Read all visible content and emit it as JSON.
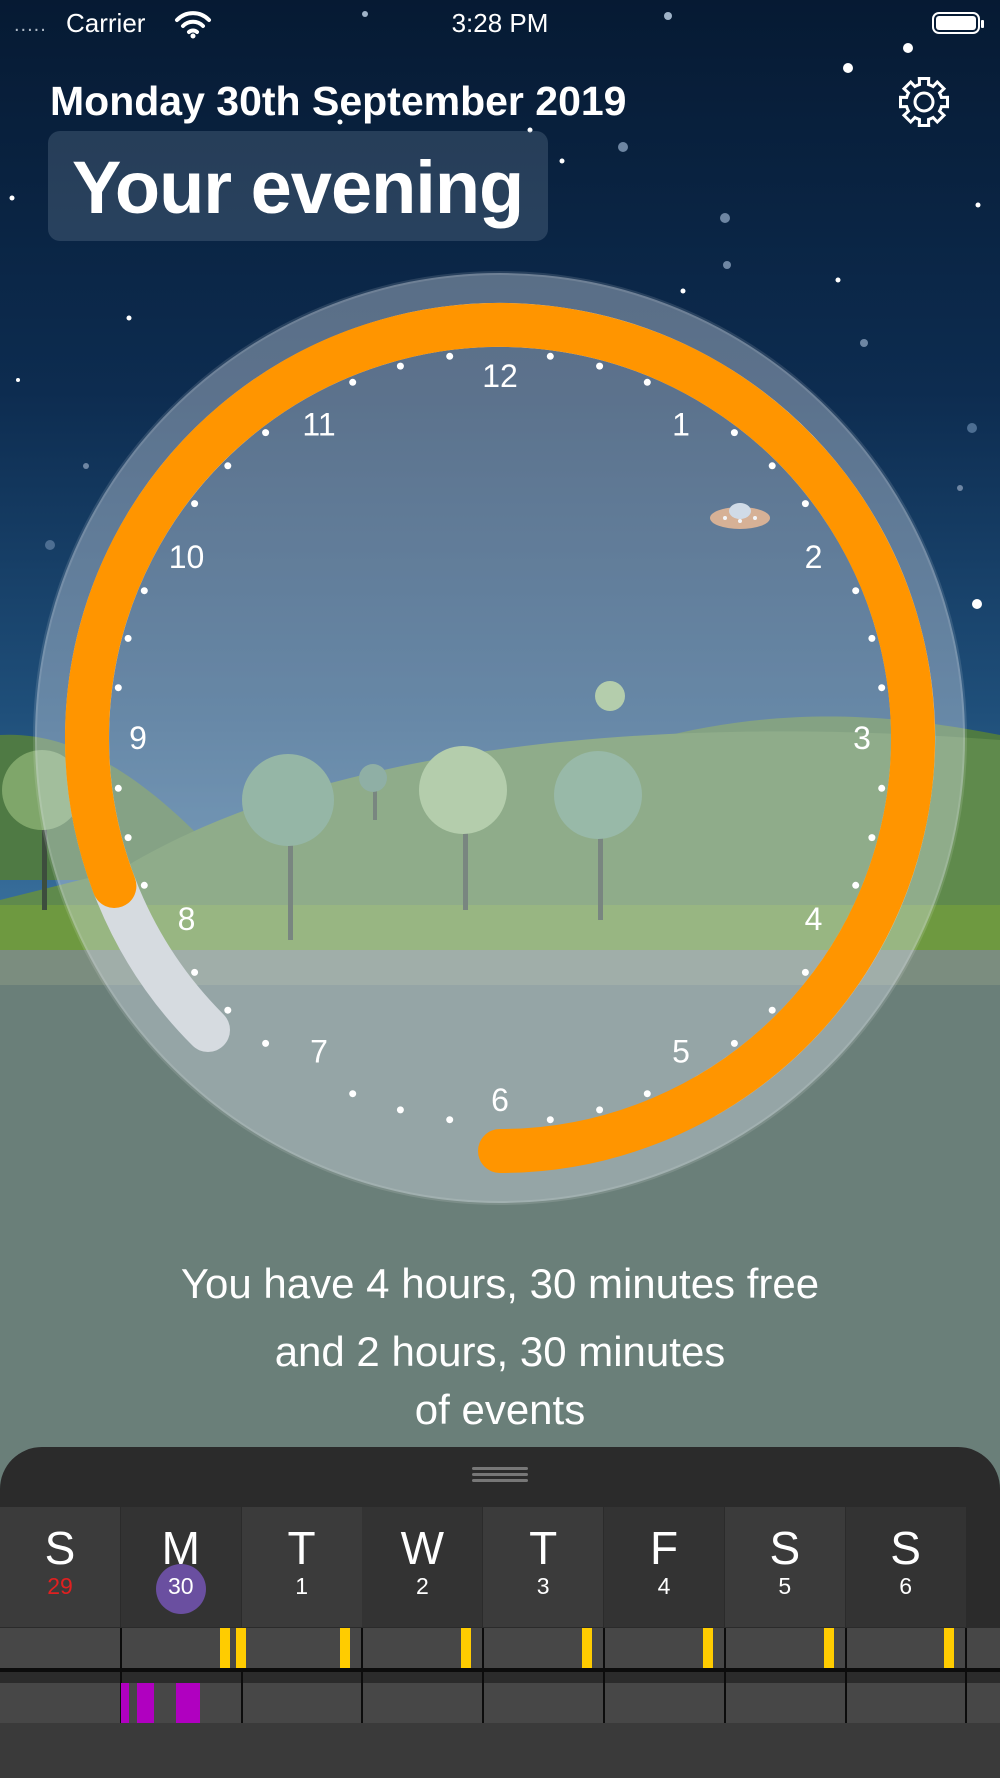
{
  "status": {
    "carrier": "Carrier",
    "time": "3:28 PM",
    "signal_dots": "....."
  },
  "header": {
    "date": "Monday 30th September 2019",
    "period": "Your evening"
  },
  "clock": {
    "hour_labels": [
      "12",
      "1",
      "2",
      "3",
      "4",
      "5",
      "6",
      "7",
      "8",
      "9",
      "10",
      "11"
    ],
    "free_arc_range": [
      7.5,
      5.0
    ],
    "events_arc_range": [
      8.3,
      6.0
    ],
    "colors": {
      "events": "#ff9500",
      "free": "#d6dbe0"
    }
  },
  "summary": {
    "line1": "You have 4 hours, 30 minutes free",
    "line2": "and 2 hours, 30 minutes",
    "line3": "of events"
  },
  "week": {
    "days": [
      {
        "letter": "S",
        "number": "29",
        "number_color": "#e02020"
      },
      {
        "letter": "M",
        "number": "30",
        "today": true
      },
      {
        "letter": "T",
        "number": "1"
      },
      {
        "letter": "W",
        "number": "2"
      },
      {
        "letter": "T",
        "number": "3"
      },
      {
        "letter": "F",
        "number": "4"
      },
      {
        "letter": "S",
        "number": "5"
      },
      {
        "letter": "S",
        "number": "6"
      }
    ],
    "colors": {
      "today_badge": "#6a4fa0",
      "marker": "#ffcc00",
      "event_block": "#b000c0"
    }
  },
  "icons": {
    "settings": "gear-icon",
    "wifi": "wifi-icon",
    "battery": "battery-icon",
    "ufo": "ufo-icon",
    "grabber": "drag-handle-icon"
  }
}
